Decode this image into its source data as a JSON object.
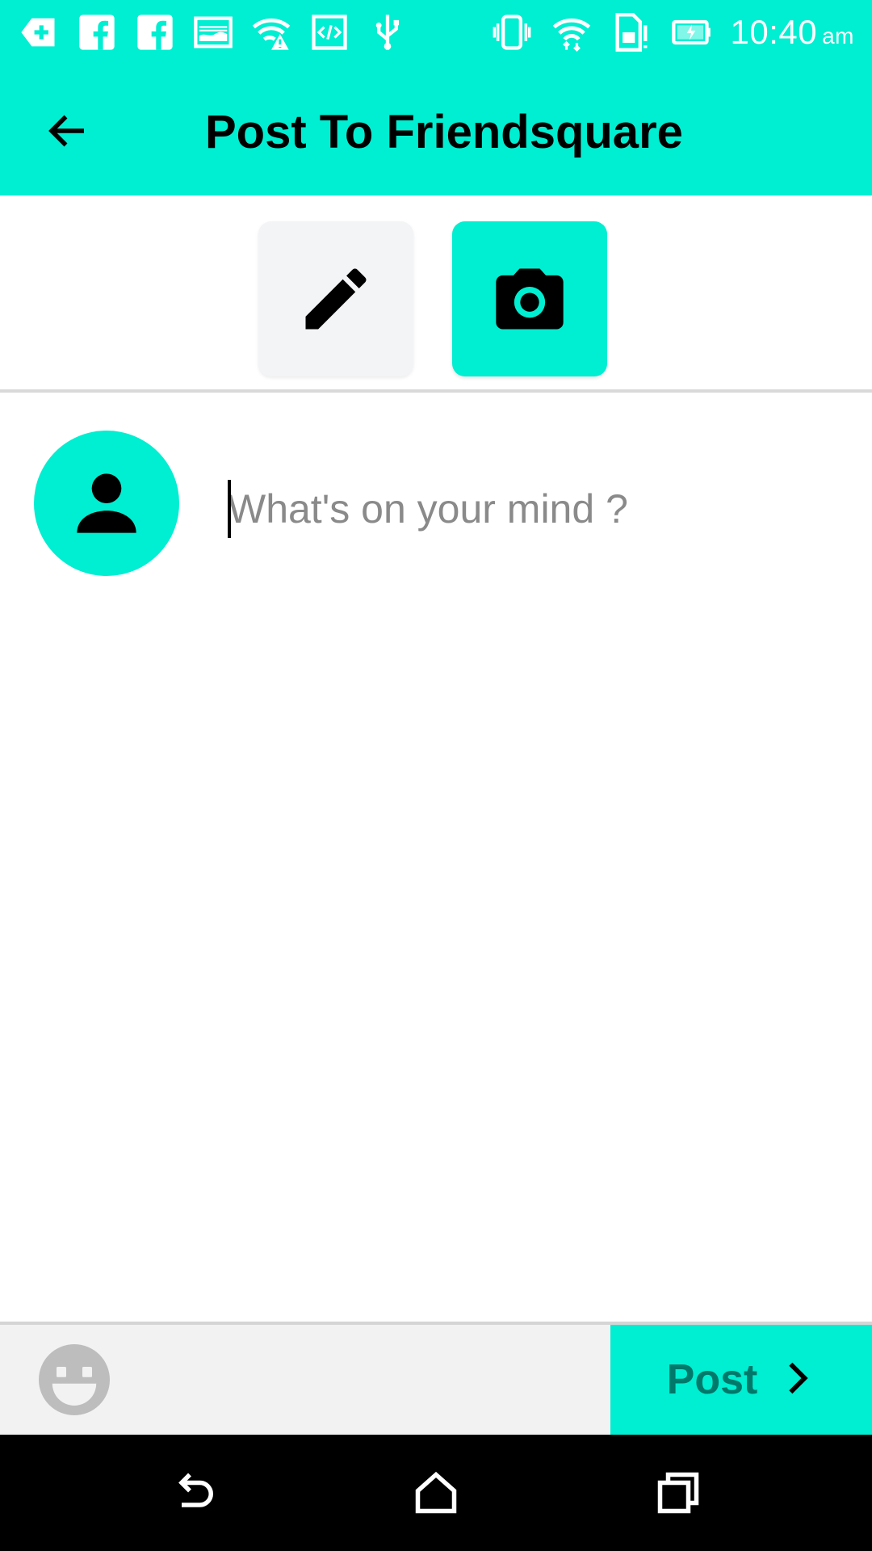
{
  "status_bar": {
    "time": "10:40",
    "ampm": "am",
    "left_icons": [
      "notification-plus-icon",
      "facebook-icon",
      "facebook-icon",
      "photo-icon",
      "wifi-warning-icon",
      "code-icon",
      "usb-icon"
    ],
    "right_icons": [
      "vibrate-icon",
      "wifi-icon",
      "sim-alert-icon",
      "battery-charging-icon"
    ]
  },
  "app_bar": {
    "title": "Post To Friendsquare",
    "back_icon": "arrow-back-icon"
  },
  "mode_selector": {
    "text_mode_icon": "pencil-icon",
    "photo_mode_icon": "camera-icon",
    "selected": "photo"
  },
  "compose": {
    "avatar_icon": "person-icon",
    "input_value": "",
    "input_placeholder": "What's on your mind ?"
  },
  "bottom_bar": {
    "emoji_icon": "smiley-icon",
    "post_label": "Post",
    "post_icon": "chevron-right-icon"
  },
  "nav_bar": {
    "icons": [
      "nav-back-icon",
      "nav-home-icon",
      "nav-recents-icon"
    ]
  },
  "colors": {
    "accent": "#00EED1",
    "post_text": "#00786A",
    "toolbar_bg": "#F2F2F2",
    "placeholder": "#8A8A8A"
  }
}
